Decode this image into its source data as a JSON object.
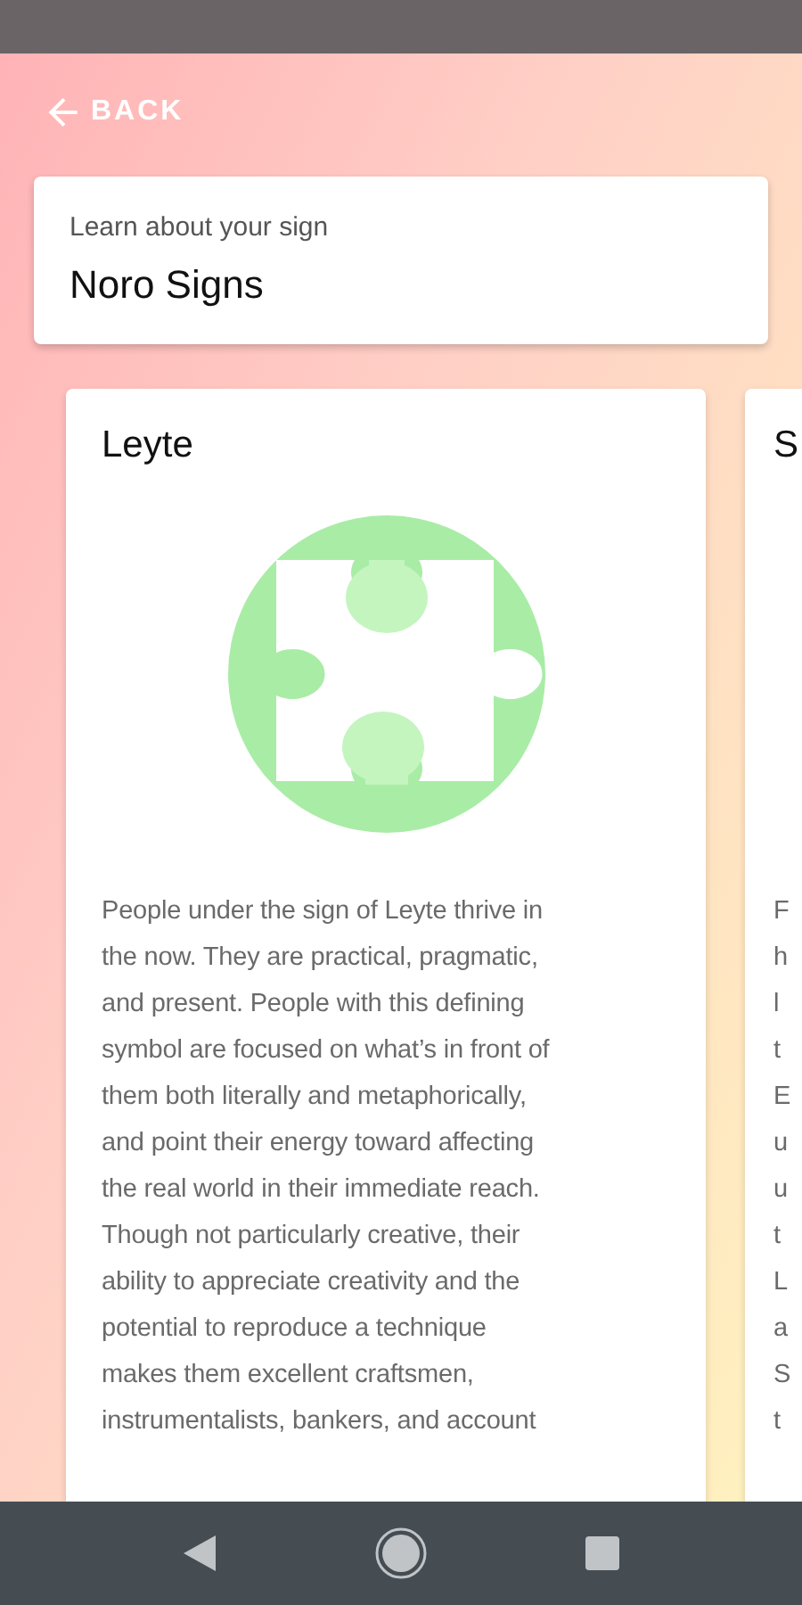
{
  "back_button": {
    "label": "BACK"
  },
  "header": {
    "subtitle": "Learn about your sign",
    "title": "Noro Signs"
  },
  "signs": [
    {
      "title": "Leyte",
      "body_lines": [
        "People under the sign of Leyte thrive in",
        "the now. They are practical, pragmatic,",
        "and present. People with this defining",
        "symbol are focused on what’s in front of",
        "them both literally and metaphorically,",
        "and point their energy toward affecting",
        "the real world in their immediate reach.",
        "Though not particularly creative, their",
        "ability to appreciate creativity and the",
        "potential to reproduce a technique",
        "makes them excellent craftsmen,",
        "instrumentalists, bankers, and account"
      ]
    },
    {
      "title": "S",
      "body_lines": [
        "F",
        "h",
        "l",
        "t",
        "E",
        "u",
        "u",
        "t",
        "L",
        "a",
        "S",
        "t"
      ]
    }
  ]
}
